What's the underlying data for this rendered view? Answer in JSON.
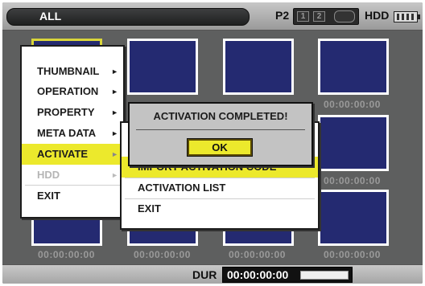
{
  "topbar": {
    "mode": "ALL",
    "card_label": "P2",
    "slots": [
      "1",
      "2"
    ],
    "hdd_label": "HDD"
  },
  "thumbnails": {
    "timecode": "00:00:00:00"
  },
  "main_menu": {
    "items": [
      {
        "label": "THUMBNAIL",
        "arrow": "►"
      },
      {
        "label": "OPERATION",
        "arrow": "►"
      },
      {
        "label": "PROPERTY",
        "arrow": "►"
      },
      {
        "label": "META DATA",
        "arrow": "►"
      },
      {
        "label": "ACTIVATE",
        "arrow": "►"
      },
      {
        "label": "HDD",
        "arrow": "►"
      },
      {
        "label": "EXIT"
      }
    ]
  },
  "sub_menu": {
    "items": [
      {
        "label": "IMPORT ACTIVATION CODE"
      },
      {
        "label": "ACTIVATION LIST"
      },
      {
        "label": "EXIT"
      }
    ]
  },
  "dialog": {
    "message": "ACTIVATION COMPLETED!",
    "ok_label": "OK"
  },
  "bottombar": {
    "dur_label": "DUR",
    "dur_value": "00:00:00:00"
  }
}
